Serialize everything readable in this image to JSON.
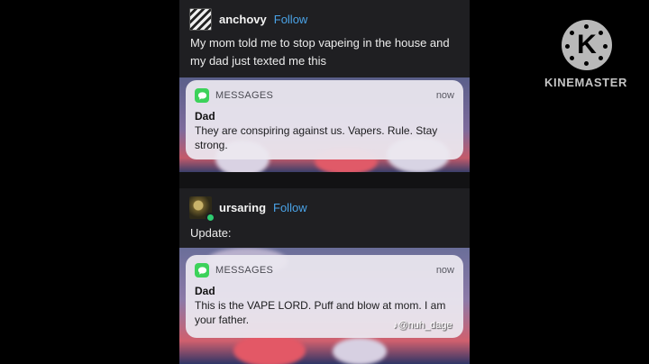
{
  "posts": [
    {
      "username": "anchovy",
      "follow_label": "Follow",
      "caption": "My mom told me to stop vapeing in the house and my dad just texted me this",
      "notification": {
        "app_name": "MESSAGES",
        "time": "now",
        "sender": "Dad",
        "body": "They are conspiring against us. Vapers. Rule. Stay strong."
      }
    },
    {
      "username": "ursaring",
      "follow_label": "Follow",
      "caption": "Update:",
      "notification": {
        "app_name": "MESSAGES",
        "time": "now",
        "sender": "Dad",
        "body": "This is the VAPE LORD. Puff and blow at mom. I am your father."
      },
      "watermark": "@nuh_dage"
    }
  ],
  "overlay": {
    "brand": "KINEMASTER",
    "logo_letter": "K"
  },
  "colors": {
    "accent_follow": "#4aa3e8",
    "messages_icon": "#3cd25a",
    "feed_background": "#1f1f22"
  },
  "icons": [
    "messages-icon",
    "kinemaster-logo",
    "tiktok-icon"
  ]
}
